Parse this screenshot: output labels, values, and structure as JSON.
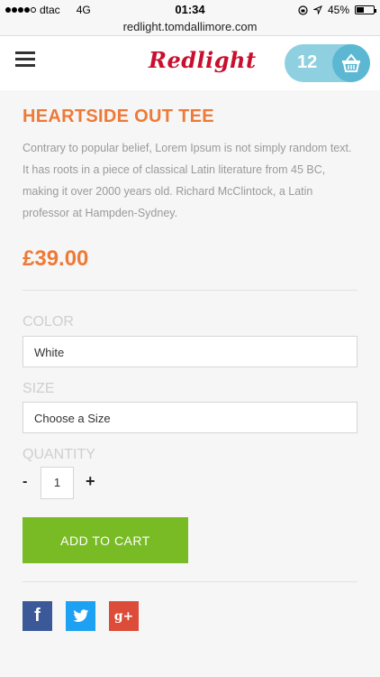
{
  "status_bar": {
    "carrier": "dtac",
    "network": "4G",
    "time": "01:34",
    "battery": "45%",
    "battery_level": 0.45,
    "url": "redlight.tomdallimore.com"
  },
  "header": {
    "logo": "Redlight",
    "cart_count": "12",
    "menu_icon": "hamburger-icon",
    "cart_icon": "basket-icon"
  },
  "product": {
    "title": "HEARTSIDE OUT TEE",
    "description": "Contrary to popular belief, Lorem Ipsum is not simply random text. It has roots in a piece of classical Latin literature from 45 BC, making it over 2000 years old. Richard McClintock, a Latin professor at Hampden-Sydney.",
    "price": "£39.00"
  },
  "options": {
    "color_label": "COLOR",
    "color_value": "White",
    "size_label": "SIZE",
    "size_value": "Choose a Size",
    "quantity_label": "QUANTITY",
    "quantity_minus": "-",
    "quantity_value": "1",
    "quantity_plus": "+"
  },
  "actions": {
    "add_to_cart": "ADD TO CART"
  },
  "social": {
    "facebook": "f",
    "googleplus": "g+"
  },
  "colors": {
    "accent": "#ee7a37",
    "button": "#79bb25",
    "cart": "#8fd0e0",
    "logo": "#c8102e",
    "facebook": "#3b5998",
    "twitter": "#1da1f2",
    "googleplus": "#dd4b39"
  }
}
